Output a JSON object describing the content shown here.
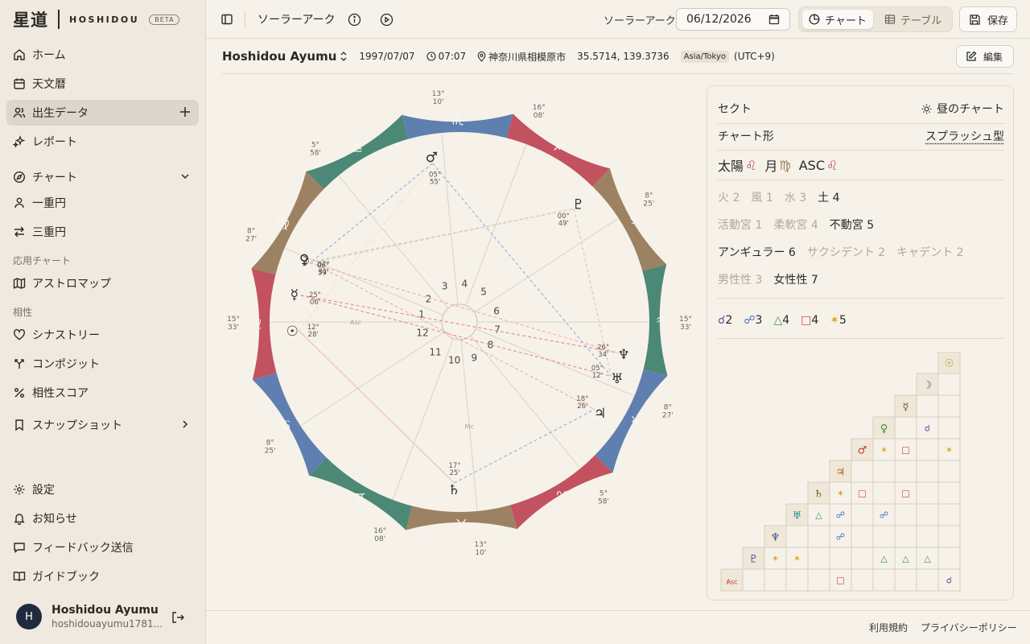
{
  "app": {
    "logo": "星道",
    "name": "HOSHIDOU",
    "badge": "BETA"
  },
  "sidebar": {
    "items": [
      {
        "label": "ホーム",
        "icon": "home-icon"
      },
      {
        "label": "天文暦",
        "icon": "calendar-icon"
      },
      {
        "label": "出生データ",
        "icon": "users-icon",
        "active": true
      },
      {
        "label": "レポート",
        "icon": "sparkles-icon"
      }
    ],
    "chart_group": {
      "label": "チャート",
      "items": [
        {
          "label": "一重円"
        },
        {
          "label": "三重円"
        }
      ]
    },
    "applied_label": "応用チャート",
    "applied_items": [
      {
        "label": "アストロマップ"
      }
    ],
    "aspect_label": "相性",
    "aspect_items": [
      {
        "label": "シナストリー"
      },
      {
        "label": "コンポジット"
      },
      {
        "label": "相性スコア"
      }
    ],
    "snapshot": {
      "label": "スナップショット"
    },
    "bottom_items": [
      {
        "label": "設定"
      },
      {
        "label": "お知らせ"
      },
      {
        "label": "フィードバック送信"
      },
      {
        "label": "ガイドブック"
      }
    ],
    "user": {
      "initial": "H",
      "name": "Hoshidou Ayumu",
      "email": "hoshidouayumu1781..."
    }
  },
  "topbar": {
    "title": "ソーラーアーク",
    "date_label": "ソーラーアーク",
    "date_value": "06/12/2026",
    "view_chart": "チャート",
    "view_table": "テーブル",
    "save": "保存"
  },
  "person": {
    "name": "Hoshidou Ayumu",
    "date": "1997/07/07",
    "time": "07:07",
    "place": "神奈川県相模原市",
    "coords": "35.5714, 139.3736",
    "tz": "Asia/Tokyo",
    "offset": "(UTC+9)",
    "edit": "編集"
  },
  "panel": {
    "sect_label": "セクト",
    "sect_value": "昼のチャート",
    "shape_label": "チャート形",
    "shape_value": "スプラッシュ型",
    "big3": [
      {
        "label": "太陽",
        "sign": "♌",
        "color": "#c0505e"
      },
      {
        "label": "月",
        "sign": "♍",
        "color": "#9b7a52"
      },
      {
        "label": "ASC",
        "sign": "♌",
        "color": "#c0505e"
      }
    ],
    "elements": [
      {
        "label": "火",
        "count": "2",
        "dim": true
      },
      {
        "label": "風",
        "count": "1",
        "dim": true
      },
      {
        "label": "水",
        "count": "3",
        "dim": true
      },
      {
        "label": "土",
        "count": "4",
        "dim": false
      }
    ],
    "modes": [
      {
        "label": "活動宮",
        "count": "1",
        "dim": true
      },
      {
        "label": "柔軟宮",
        "count": "4",
        "dim": true
      },
      {
        "label": "不動宮",
        "count": "5",
        "dim": false
      }
    ],
    "houses": [
      {
        "label": "アンギュラー",
        "count": "6",
        "dim": false
      },
      {
        "label": "サクシデント",
        "count": "2",
        "dim": true
      },
      {
        "label": "キャデント",
        "count": "2",
        "dim": true
      }
    ],
    "polarity": [
      {
        "label": "男性性",
        "count": "3",
        "dim": true
      },
      {
        "label": "女性性",
        "count": "7",
        "dim": false
      }
    ],
    "aspects": [
      {
        "glyph": "☌",
        "count": "2",
        "color": "#7a3fa0"
      },
      {
        "glyph": "☍",
        "count": "3",
        "color": "#3b6fc8"
      },
      {
        "glyph": "△",
        "count": "4",
        "color": "#3a9a4a"
      },
      {
        "glyph": "□",
        "count": "4",
        "color": "#d04545"
      },
      {
        "glyph": "✶",
        "count": "5",
        "color": "#d9a21a"
      }
    ],
    "grid_planets": [
      "☉",
      "☽",
      "☿",
      "♀",
      "♂",
      "♃",
      "♄",
      "♅",
      "♆",
      "♇",
      "Asc"
    ],
    "grid_planet_colors": [
      "#b48a2a",
      "#5a4aa0",
      "#6b6055",
      "#3a8a3a",
      "#c03535",
      "#c05a20",
      "#7a5a30",
      "#2a8a8a",
      "#3a4a9a",
      "#6a3a9a",
      "#c03535"
    ],
    "grid_cells": [
      {
        "r": 3,
        "c": 1,
        "g": "☌"
      },
      {
        "r": 4,
        "c": 0,
        "g": "✶"
      },
      {
        "r": 4,
        "c": 1,
        "g": "□"
      },
      {
        "r": 4,
        "c": 3,
        "g": "✶"
      },
      {
        "r": 6,
        "c": 0,
        "g": "✶"
      },
      {
        "r": 6,
        "c": 1,
        "g": "□"
      },
      {
        "r": 6,
        "c": 3,
        "g": "□"
      },
      {
        "r": 7,
        "c": 0,
        "g": "△"
      },
      {
        "r": 7,
        "c": 1,
        "g": "☍"
      },
      {
        "r": 7,
        "c": 3,
        "g": "☍"
      },
      {
        "r": 8,
        "c": 2,
        "g": "☍"
      },
      {
        "r": 9,
        "c": 0,
        "g": "✶"
      },
      {
        "r": 9,
        "c": 1,
        "g": "✶"
      },
      {
        "r": 9,
        "c": 5,
        "g": "△"
      },
      {
        "r": 9,
        "c": 6,
        "g": "△"
      },
      {
        "r": 9,
        "c": 7,
        "g": "△"
      },
      {
        "r": 10,
        "c": 4,
        "g": "□"
      },
      {
        "r": 10,
        "c": 9,
        "g": "☌"
      }
    ]
  },
  "wheel": {
    "signs": [
      "♈",
      "♉",
      "♊",
      "♋",
      "♌",
      "♍",
      "♎",
      "♏",
      "♐",
      "♑",
      "♒",
      "♓"
    ],
    "sign_colors": [
      "#c2525f",
      "#9c8262",
      "#4c8876",
      "#5f7fb0"
    ],
    "asc_longitude": 135.55,
    "cusps": [
      {
        "lon": 135.55,
        "deg": "15°",
        "min": "33'"
      },
      {
        "lon": 158.45,
        "deg": "8°",
        "min": "27'"
      },
      {
        "lon": 185.97,
        "deg": "5°",
        "min": "58'"
      },
      {
        "lon": 220.17,
        "deg": "13°",
        "min": "10'"
      },
      {
        "lon": 246.13,
        "deg": "16°",
        "min": "08'"
      },
      {
        "lon": 282.42,
        "deg": "8°",
        "min": "25'"
      },
      {
        "lon": 315.55,
        "deg": "15°",
        "min": "33'"
      },
      {
        "lon": 338.45,
        "deg": "8°",
        "min": "27'"
      },
      {
        "lon": 5.97,
        "deg": "5°",
        "min": "58'"
      },
      {
        "lon": 40.17,
        "deg": "13°",
        "min": "10'"
      },
      {
        "lon": 66.13,
        "deg": "16°",
        "min": "08'"
      },
      {
        "lon": 102.42,
        "deg": "8°",
        "min": "25'"
      }
    ],
    "house_numbers": [
      "1",
      "2",
      "3",
      "4",
      "5",
      "6",
      "7",
      "8",
      "9",
      "10",
      "11",
      "12"
    ],
    "planets": [
      {
        "glyph": "☉",
        "deg": "12°",
        "min": "28'",
        "lon": 132.47
      },
      {
        "glyph": "☿",
        "deg": "25°",
        "min": "06'",
        "lon": 145.1
      },
      {
        "glyph": "☽",
        "deg": "06°",
        "min": "59'",
        "lon": 156.98
      },
      {
        "glyph": "♀",
        "deg": "07°",
        "min": "31'",
        "lon": 157.52
      },
      {
        "glyph": "♂",
        "deg": "05°",
        "min": "55'",
        "lon": 215.92
      },
      {
        "glyph": "♇",
        "deg": "00°",
        "min": "49'",
        "lon": 270.82
      },
      {
        "glyph": "♆",
        "deg": "26°",
        "min": "34'",
        "lon": 326.57
      },
      {
        "glyph": "♅",
        "deg": "05°",
        "min": "12'",
        "lon": 335.2
      },
      {
        "glyph": "♃",
        "deg": "18°",
        "min": "26'",
        "lon": 348.43
      },
      {
        "glyph": "♄",
        "deg": "17°",
        "min": "25'",
        "lon": 47.42
      }
    ],
    "angle_labels": {
      "asc": "Asc",
      "mc": "Mc"
    }
  },
  "footer": {
    "terms": "利用規約",
    "privacy": "プライバシーポリシー"
  }
}
